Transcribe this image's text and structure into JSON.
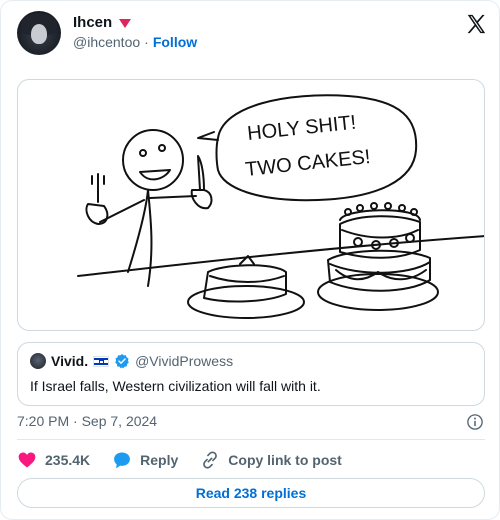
{
  "author": {
    "name": "Ihcen",
    "handle": "@ihcentoo",
    "separator": "·",
    "follow_label": "Follow",
    "badge_icon": "heart-icon",
    "badge_color": "#e0245e"
  },
  "media": {
    "speech_line_1": "HOLY SHIT!",
    "speech_line_2": "TWO CAKES!"
  },
  "quote": {
    "name": "Vivid.",
    "flag_icon": "israel-flag-icon",
    "verified_icon": "verified-badge-icon",
    "handle": "@VividProwess",
    "text": "If Israel falls, Western civilization will fall with it."
  },
  "meta": {
    "timestamp": "7:20 PM · Sep 7, 2024"
  },
  "actions": {
    "like_count": "235.4K",
    "reply_label": "Reply",
    "copy_label": "Copy link to post",
    "like_color": "#f91880",
    "reply_color": "#1d9bf0"
  },
  "footer": {
    "read_replies_label": "Read 238 replies"
  },
  "colors": {
    "link": "#006fd6",
    "muted": "#536471",
    "border": "#cfd9de"
  }
}
